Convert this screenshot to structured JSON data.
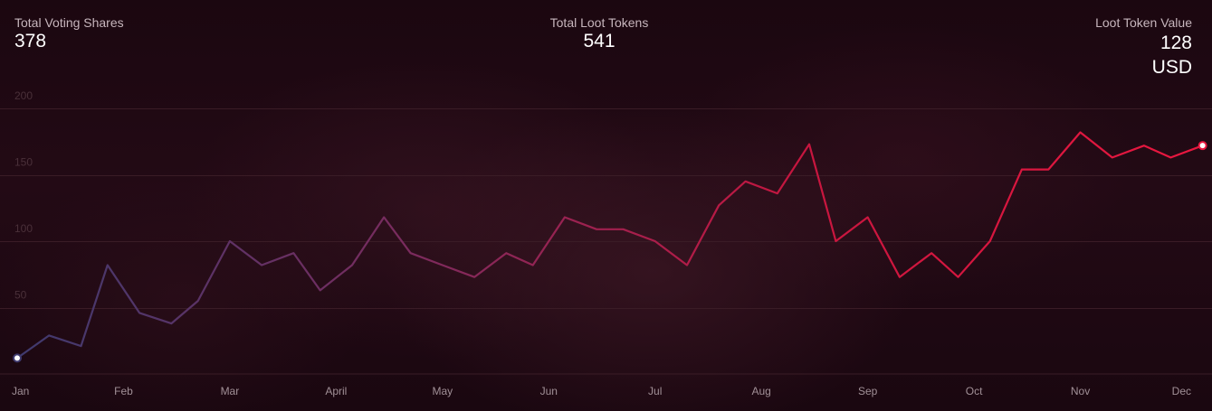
{
  "stats": {
    "voting_shares": {
      "label": "Total Voting Shares",
      "value": "378"
    },
    "loot_tokens": {
      "label": "Total Loot Tokens",
      "value": "541"
    },
    "loot_value": {
      "label": "Loot Token Value",
      "value": "128",
      "unit": "USD"
    }
  },
  "chart_data": {
    "type": "line",
    "title": "",
    "xlabel": "",
    "ylabel": "",
    "categories": [
      "Jan",
      "Feb",
      "Mar",
      "April",
      "May",
      "Jun",
      "Jul",
      "Aug",
      "Sep",
      "Oct",
      "Nov",
      "Dec"
    ],
    "x": [
      0,
      0.3,
      0.6,
      0.85,
      1.15,
      1.45,
      1.7,
      2.0,
      2.3,
      2.6,
      2.85,
      3.15,
      3.45,
      3.7,
      4.0,
      4.3,
      4.6,
      4.85,
      5.15,
      5.45,
      5.7,
      6.0,
      6.3,
      6.6,
      6.85,
      7.15,
      7.45,
      7.7,
      8.0,
      8.3,
      8.6,
      8.85,
      9.15,
      9.45,
      9.7,
      10.0,
      10.3,
      10.6,
      10.85,
      11.15
    ],
    "y": [
      12,
      29,
      21,
      82,
      46,
      38,
      55,
      100,
      82,
      91,
      63,
      82,
      118,
      91,
      82,
      73,
      91,
      82,
      118,
      109,
      109,
      100,
      82,
      127,
      145,
      136,
      173,
      100,
      118,
      73,
      91,
      73,
      100,
      154,
      154,
      182,
      163,
      172,
      163,
      172
    ],
    "y_ticks": [
      50,
      100,
      150,
      200
    ],
    "ylim": [
      0,
      200
    ],
    "grid": true,
    "line_gradient": [
      "#3f3a6e",
      "#7a2b5e",
      "#c6163f",
      "#e8173f"
    ],
    "grid_color": "#3a1c26",
    "marker_start_color": "#3f3a6e",
    "marker_end_color": "#e8173f"
  }
}
